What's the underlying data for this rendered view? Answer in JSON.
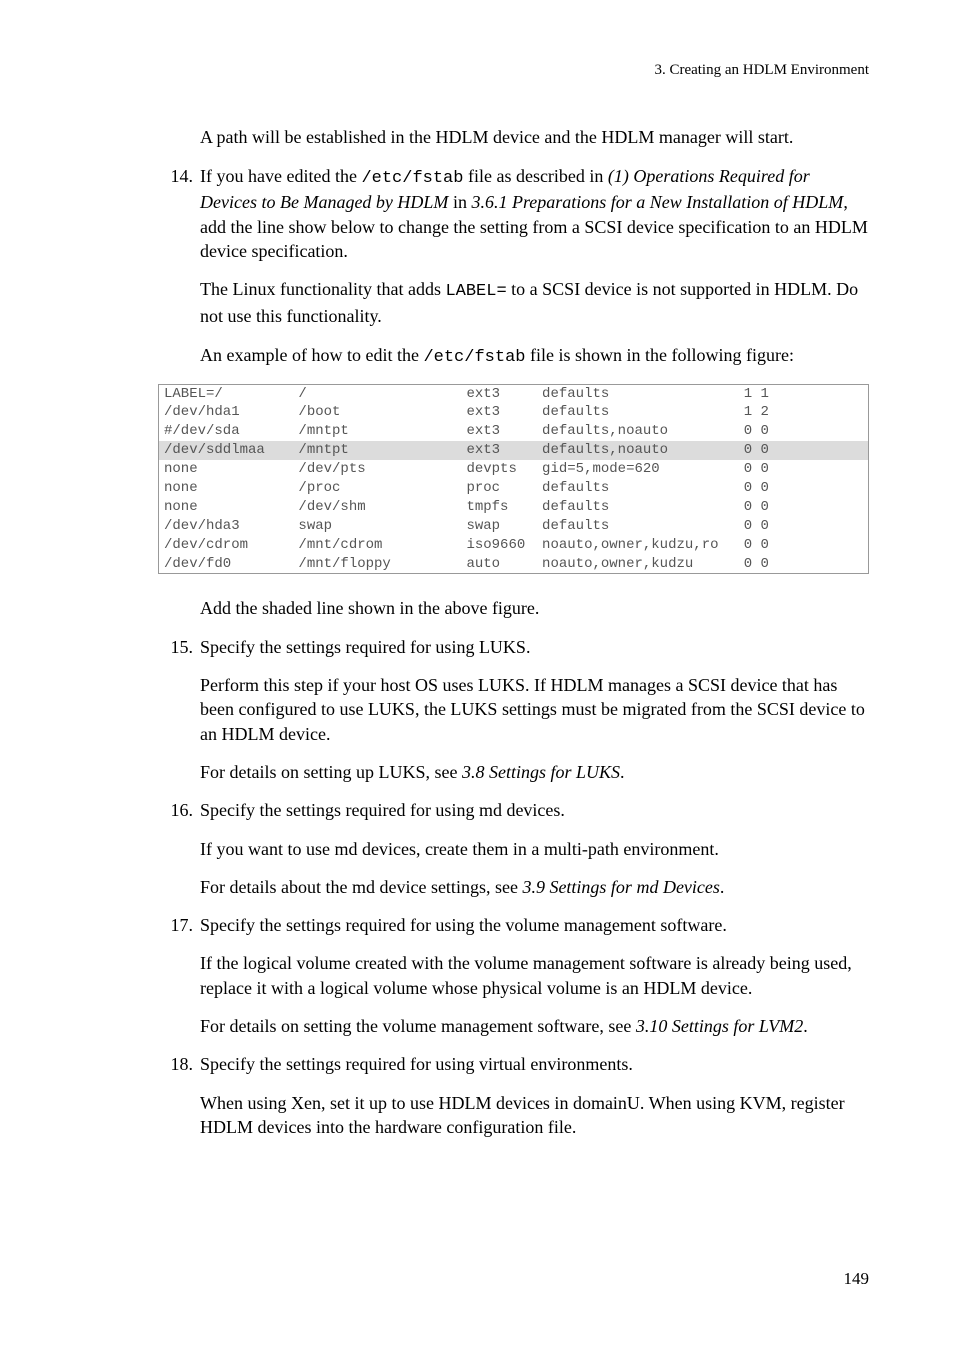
{
  "header": {
    "chapter": "3.  Creating an HDLM Environment"
  },
  "intro_para": "A path will be established in the HDLM device and the HDLM manager will start.",
  "step14": {
    "number": "14.",
    "t1": "If you have edited the ",
    "code1": "/etc/fstab",
    "t2": " file as described in ",
    "ref1": "(1)  Operations Required for Devices to Be Managed by HDLM",
    "t3": " in ",
    "ref2": "3.6.1  Preparations for a New Installation of HDLM",
    "t4": ", add the line show below to change the setting from a SCSI device specification to an HDLM device specification.",
    "p2a": "The Linux functionality that adds ",
    "p2code": "LABEL=",
    "p2b": " to a SCSI device is not supported in HDLM. Do not use this functionality.",
    "p3a": "An example of how to edit the ",
    "p3code": "/etc/fstab",
    "p3b": " file is shown in the following figure:"
  },
  "fstab": [
    {
      "c1": "LABEL=/",
      "c2": "/",
      "c3": "ext3",
      "c4": "defaults",
      "c5": "1 1",
      "shaded": false
    },
    {
      "c1": "/dev/hda1",
      "c2": "/boot",
      "c3": "ext3",
      "c4": "defaults",
      "c5": "1 2",
      "shaded": false
    },
    {
      "c1": "#/dev/sda",
      "c2": "/mntpt",
      "c3": "ext3",
      "c4": "defaults,noauto",
      "c5": "0 0",
      "shaded": false
    },
    {
      "c1": "/dev/sddlmaa",
      "c2": "/mntpt",
      "c3": "ext3",
      "c4": "defaults,noauto",
      "c5": "0 0",
      "shaded": true
    },
    {
      "c1": "none",
      "c2": "/dev/pts",
      "c3": "devpts",
      "c4": "gid=5,mode=620",
      "c5": "0 0",
      "shaded": false
    },
    {
      "c1": "none",
      "c2": "/proc",
      "c3": "proc",
      "c4": "defaults",
      "c5": "0 0",
      "shaded": false
    },
    {
      "c1": "none",
      "c2": "/dev/shm",
      "c3": "tmpfs",
      "c4": "defaults",
      "c5": "0 0",
      "shaded": false
    },
    {
      "c1": "/dev/hda3",
      "c2": "swap",
      "c3": "swap",
      "c4": "defaults",
      "c5": "0 0",
      "shaded": false
    },
    {
      "c1": "/dev/cdrom",
      "c2": "/mnt/cdrom",
      "c3": "iso9660",
      "c4": "noauto,owner,kudzu,ro",
      "c5": "0 0",
      "shaded": false
    },
    {
      "c1": "/dev/fd0",
      "c2": "/mnt/floppy",
      "c3": "auto",
      "c4": "noauto,owner,kudzu",
      "c5": "0 0",
      "shaded": false
    }
  ],
  "after_fstab": "Add the shaded line shown in the above figure.",
  "step15": {
    "number": "15.",
    "title": "Specify the settings required for using LUKS.",
    "p1": "Perform this step if your host OS uses LUKS. If HDLM manages a SCSI device that has been configured to use LUKS, the LUKS settings must be migrated from the SCSI device to an HDLM device.",
    "p2a": "For details on setting up LUKS, see ",
    "p2ref": "3.8  Settings for LUKS",
    "p2b": "."
  },
  "step16": {
    "number": "16.",
    "title": "Specify the settings required for using md devices.",
    "p1": "If you want to use md devices, create them in a multi-path environment.",
    "p2a": "For details about the md device settings, see ",
    "p2ref": "3.9  Settings for md Devices",
    "p2b": "."
  },
  "step17": {
    "number": "17.",
    "title": "Specify the settings required for using the volume management software.",
    "p1": "If the logical volume created with the volume management software is already being used, replace it with a logical volume whose physical volume is an HDLM device.",
    "p2a": "For details on setting the volume management software, see ",
    "p2ref": "3.10  Settings for LVM2",
    "p2b": "."
  },
  "step18": {
    "number": "18.",
    "title": "Specify the settings required for using virtual environments.",
    "p1": "When using Xen, set it up to use HDLM devices in domainU. When using KVM, register HDLM devices into the hardware configuration file."
  },
  "page_number": "149"
}
